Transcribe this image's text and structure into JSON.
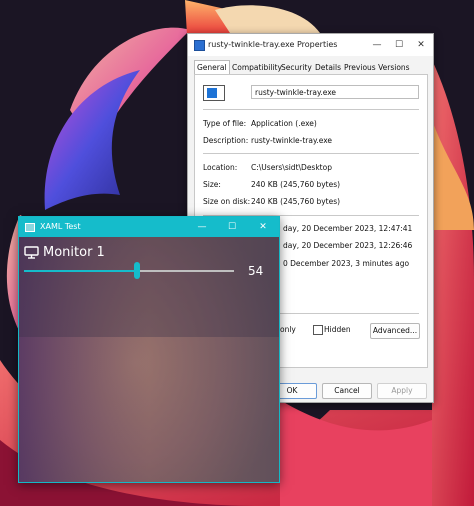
{
  "properties": {
    "title": "rusty-twinkle-tray.exe Properties",
    "window_controls": {
      "minimize": "—",
      "maximize": "☐",
      "close": "✕"
    },
    "tabs": [
      "General",
      "Compatibility",
      "Security",
      "Details",
      "Previous Versions"
    ],
    "active_tab": "General",
    "file_name": "rusty-twinkle-tray.exe",
    "rows": {
      "type_label": "Type of file:",
      "type_value": "Application (.exe)",
      "desc_label": "Description:",
      "desc_value": "rusty-twinkle-tray.exe",
      "location_label": "Location:",
      "location_value": "C:\\Users\\sidt\\Desktop",
      "size_label": "Size:",
      "size_value": "240 KB (245,760 bytes)",
      "disk_label": "Size on disk:",
      "disk_value": "240 KB (245,760 bytes)",
      "created_value": "day, 20 December 2023, 12:47:41",
      "modified_value": "day, 20 December 2023, 12:26:46",
      "accessed_value": "0 December 2023, 3 minutes ago"
    },
    "attributes": {
      "readonly_label": "only",
      "hidden_label": "Hidden",
      "advanced_label": "Advanced..."
    },
    "buttons": {
      "ok": "OK",
      "cancel": "Cancel",
      "apply": "Apply"
    }
  },
  "xaml": {
    "title": "XAML Test",
    "window_controls": {
      "minimize": "—",
      "maximize": "☐",
      "close": "✕"
    },
    "monitor_label": "Monitor 1",
    "brightness": 54,
    "brightness_max": 100,
    "accent_color": "#15bccb",
    "icons": {
      "monitor": "monitor-icon"
    }
  }
}
